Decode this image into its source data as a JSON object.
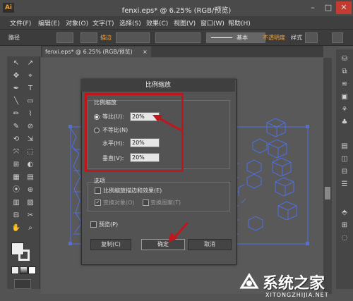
{
  "window": {
    "title": "fenxi.eps* @ 6.25% (RGB/预览)",
    "min": "–",
    "max": "□",
    "close": "✕"
  },
  "menu": [
    "文件(F)",
    "编辑(E)",
    "对象(O)",
    "文字(T)",
    "选择(S)",
    "效果(C)",
    "视图(V)",
    "窗口(W)",
    "帮助(H)"
  ],
  "control_bar": {
    "path_label": "路径",
    "stroke_label": "描边",
    "basic_label": "基本",
    "opacity_label": "不透明度",
    "style_label": "样式"
  },
  "document_tab": {
    "label": "fenxi.eps* @ 6.25% (RGB/预览)",
    "close": "×"
  },
  "dialog": {
    "title": "比例缩放",
    "group_scale": "比例缩放",
    "uniform_label": "等比(U):",
    "uniform_value": "20%",
    "nonuniform_label": "不等比(N)",
    "horizontal_label": "水平(H):",
    "horizontal_value": "20%",
    "vertical_label": "垂直(V):",
    "vertical_value": "20%",
    "options_title": "选项",
    "scale_strokes_label": "比例缩放描边和效果(E)",
    "transform_objects_label": "变换对象(O)",
    "transform_patterns_label": "变换图案(T)",
    "preview_label": "预览(P)",
    "copy_button": "复制(C)",
    "ok_button": "确定",
    "cancel_button": "取消"
  },
  "tools": [
    "↖",
    "↗",
    "✥",
    "⌖",
    "✒",
    "T",
    "╲",
    "▭",
    "✏",
    "⌇",
    "✎",
    "⊘",
    "⟲",
    "⇲",
    "⤧",
    "⬚",
    "⊞",
    "◐",
    "▦",
    "▤",
    "⦿",
    "⊕",
    "▥",
    "▨",
    "⊟",
    "✂",
    "✋",
    "⌕"
  ],
  "right_panel_icons": [
    "⛁",
    "⧉",
    "≋",
    "▣",
    "⚘",
    "♣",
    "▤",
    "◫",
    "⊟",
    "☰",
    "⬘",
    "⊞",
    "◌"
  ],
  "watermark": {
    "name": "系统之家",
    "url": "XITONGZHIJIA.NET"
  },
  "colors": {
    "highlight": "#c0161c",
    "vector": "#4f6fe8"
  }
}
